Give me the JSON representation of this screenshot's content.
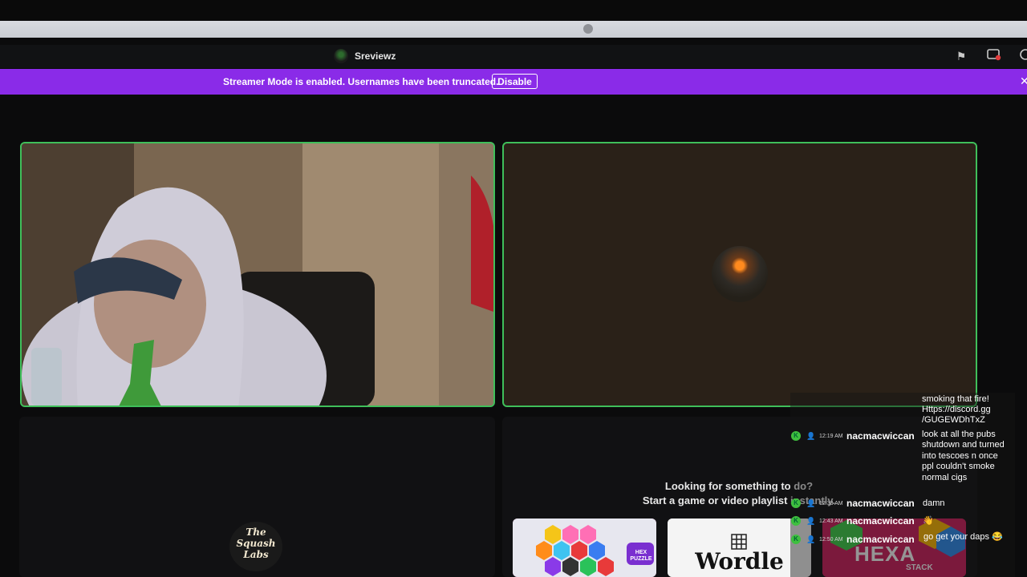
{
  "window": {
    "channel_name": "Sreviewz"
  },
  "banner": {
    "text": "Streamer Mode is enabled. Usernames have been truncated.",
    "button_label": "Disable",
    "color": "#8a2be8"
  },
  "activity": {
    "line1": "Looking for something to do?",
    "line2": "Start a game or video playlist instantly.",
    "cards": [
      {
        "title": "HEX PUZZLE"
      },
      {
        "title": "Wordle"
      },
      {
        "title": "HEXA",
        "subtitle": "STACK"
      }
    ]
  },
  "logo": {
    "text": "The Squash Labs"
  },
  "chat": [
    {
      "time": "",
      "user": "",
      "message": "smoking that fire! Https://discord.gg /GUGEWDhTxZ"
    },
    {
      "time": "12:19 AM",
      "user": "nacmacwiccan",
      "message": "look at all the pubs shutdown and turned into tescoes n once ppl couldn't smoke normal cigs"
    },
    {
      "time": "12:33 AM",
      "user": "nacmacwiccan",
      "message": "damn"
    },
    {
      "time": "12:43 AM",
      "user": "nacmacwiccan",
      "message": "👋"
    },
    {
      "time": "12:50 AM",
      "user": "nacmacwiccan",
      "message": "go get your daps 😂"
    }
  ],
  "colors": {
    "speaking_border": "#3fbf5a",
    "accent": "#8a2be8"
  },
  "icons": [
    "flag-icon",
    "screen-share-icon",
    "help-icon",
    "close-icon"
  ]
}
